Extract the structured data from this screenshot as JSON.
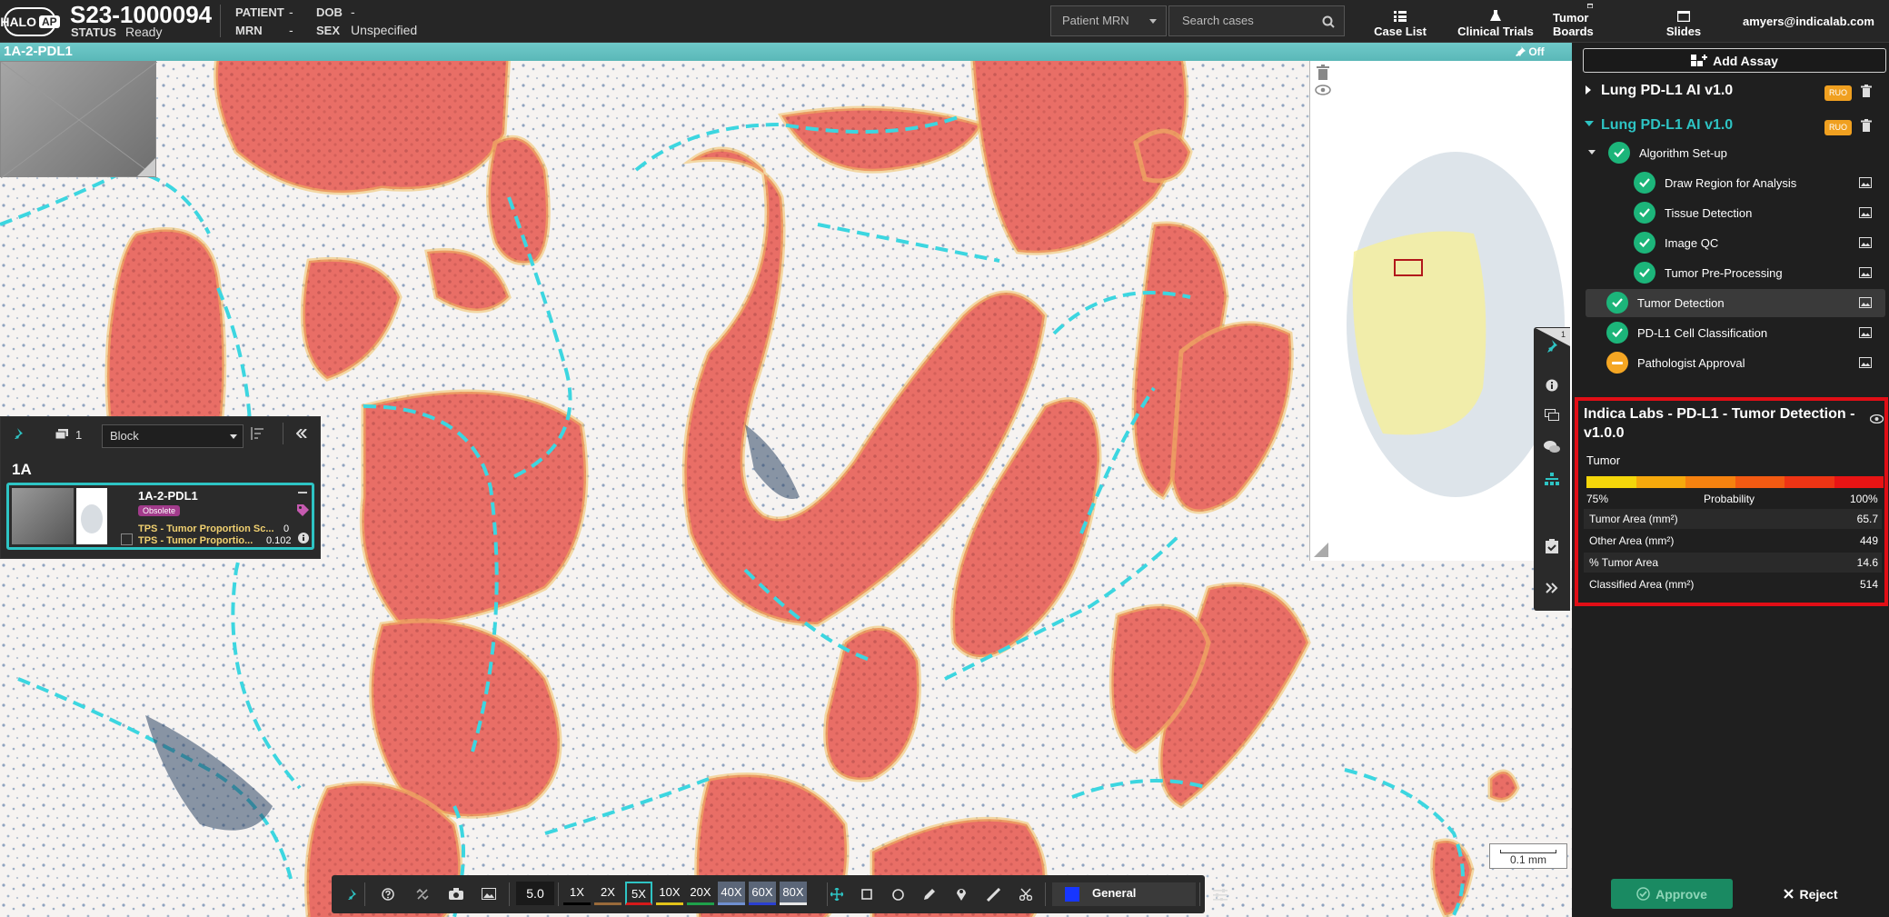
{
  "header": {
    "case_id": "S23-1000094",
    "status_label": "STATUS",
    "status_value": "Ready",
    "patient_label": "PATIENT",
    "patient_value": "-",
    "mrn_label": "MRN",
    "mrn_value": "-",
    "dob_label": "DOB",
    "dob_value": "-",
    "sex_label": "SEX",
    "sex_value": "Unspecified",
    "search_scope": "Patient MRN",
    "search_placeholder": "Search cases",
    "nav": [
      "Case List",
      "Clinical Trials",
      "Tumor Boards",
      "Slides"
    ],
    "user": "amyers@indicalab.com",
    "logo_text": "HALO",
    "logo_badge": "AP"
  },
  "viewer": {
    "slide_name": "1A-2-PDL1",
    "overlay_toggle": "Off",
    "scale_label": "0.1 mm"
  },
  "stack": {
    "count": "1",
    "group_by": "Block",
    "block_label": "1A",
    "slide": {
      "name": "1A-2-PDL1",
      "badge": "Obsolete",
      "metric1_label": "TPS - Tumor Proportion Sc...",
      "metric1_value": "0",
      "metric2_label": "TPS - Tumor Proportio...",
      "metric2_value": "0.102"
    }
  },
  "toolbar": {
    "zoom_value": "5.0",
    "zoom_levels": [
      "1X",
      "2X",
      "5X",
      "10X",
      "20X",
      "40X",
      "60X",
      "80X"
    ],
    "zoom_colors": [
      "#000000",
      "#9a6a3a",
      "#d61a1a",
      "#e2c21a",
      "#1fa04a",
      "#6f8fd0",
      "#2a3fd0",
      "#e6e6e6"
    ],
    "active_zoom": "5X",
    "class_label": "General",
    "class_color": "#1736ff"
  },
  "panel": {
    "add_assay": "Add Assay",
    "assays": [
      {
        "title": "Lung PD-L1 AI v1.0",
        "badge": "RUO",
        "expanded": false
      },
      {
        "title": "Lung PD-L1 AI v1.0",
        "badge": "RUO",
        "expanded": true
      }
    ],
    "group": "Algorithm Set-up",
    "steps": [
      {
        "label": "Draw Region for Analysis",
        "status": "done"
      },
      {
        "label": "Tissue Detection",
        "status": "done"
      },
      {
        "label": "Image QC",
        "status": "done"
      },
      {
        "label": "Tumor Pre-Processing",
        "status": "done"
      },
      {
        "label": "Tumor Detection",
        "status": "done"
      },
      {
        "label": "PD-L1 Cell Classification",
        "status": "done"
      },
      {
        "label": "Pathologist Approval",
        "status": "pending"
      }
    ],
    "results": {
      "title": "Indica Labs - PD-L1 - Tumor Detection - v1.0.0",
      "class_name": "Tumor",
      "scale_min": "75%",
      "scale_mid": "Probability",
      "scale_max": "100%",
      "scale_colors": [
        "#f4d60a",
        "#f5a90c",
        "#f5820f",
        "#f25a12",
        "#ee3414",
        "#e81414"
      ],
      "rows": [
        {
          "label": "Tumor Area (mm²)",
          "value": "65.7"
        },
        {
          "label": "Other Area (mm²)",
          "value": "449"
        },
        {
          "label": "% Tumor Area",
          "value": "14.6"
        },
        {
          "label": "Classified Area (mm²)",
          "value": "514"
        }
      ]
    },
    "approve": "Approve",
    "reject": "Reject",
    "side_badge": "1"
  }
}
